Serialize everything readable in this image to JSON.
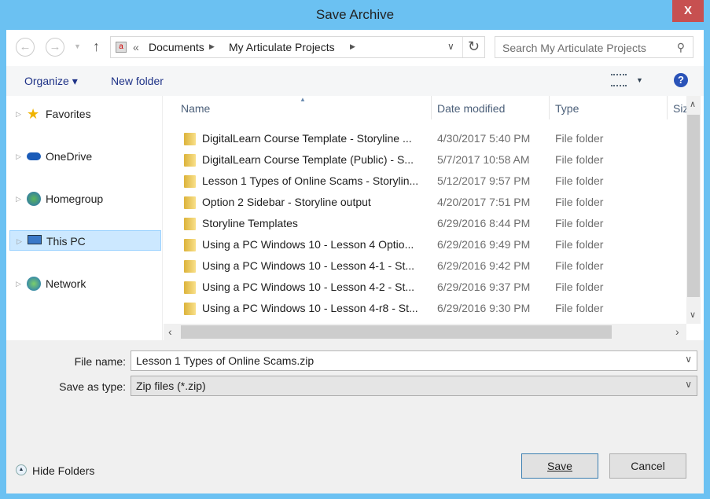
{
  "window": {
    "title": "Save Archive",
    "close": "X"
  },
  "address": {
    "sep": "«",
    "crumbs": [
      "Documents",
      "My Articulate Projects"
    ],
    "search_placeholder": "Search My Articulate Projects"
  },
  "toolbar": {
    "organize": "Organize ▾",
    "new_folder": "New folder",
    "help": "?"
  },
  "nav": [
    {
      "label": "Favorites"
    },
    {
      "label": "OneDrive"
    },
    {
      "label": "Homegroup"
    },
    {
      "label": "This PC"
    },
    {
      "label": "Network"
    }
  ],
  "columns": {
    "name": "Name",
    "date": "Date modified",
    "type": "Type",
    "size": "Siz"
  },
  "files": [
    {
      "name": "DigitalLearn Course Template - Storyline ...",
      "date": "4/30/2017 5:40 PM",
      "type": "File folder"
    },
    {
      "name": "DigitalLearn Course Template (Public) - S...",
      "date": "5/7/2017 10:58 AM",
      "type": "File folder"
    },
    {
      "name": "Lesson 1 Types of Online Scams - Storylin...",
      "date": "5/12/2017 9:57 PM",
      "type": "File folder"
    },
    {
      "name": "Option 2 Sidebar - Storyline output",
      "date": "4/20/2017 7:51 PM",
      "type": "File folder"
    },
    {
      "name": "Storyline Templates",
      "date": "6/29/2016 8:44 PM",
      "type": "File folder"
    },
    {
      "name": "Using a PC Windows 10 - Lesson 4 Optio...",
      "date": "6/29/2016 9:49 PM",
      "type": "File folder"
    },
    {
      "name": "Using a PC Windows 10 - Lesson 4-1 - St...",
      "date": "6/29/2016 9:42 PM",
      "type": "File folder"
    },
    {
      "name": "Using a PC Windows 10 - Lesson 4-2 - St...",
      "date": "6/29/2016 9:37 PM",
      "type": "File folder"
    },
    {
      "name": "Using a PC Windows 10 - Lesson 4-r8 - St...",
      "date": "6/29/2016 9:30 PM",
      "type": "File folder"
    }
  ],
  "form": {
    "file_name_label": "File name:",
    "file_name": "Lesson 1 Types of Online Scams.zip",
    "type_label": "Save as type:",
    "type_value": "Zip files (*.zip)"
  },
  "footer": {
    "hide_folders": "Hide Folders",
    "save": "Save",
    "cancel": "Cancel"
  }
}
